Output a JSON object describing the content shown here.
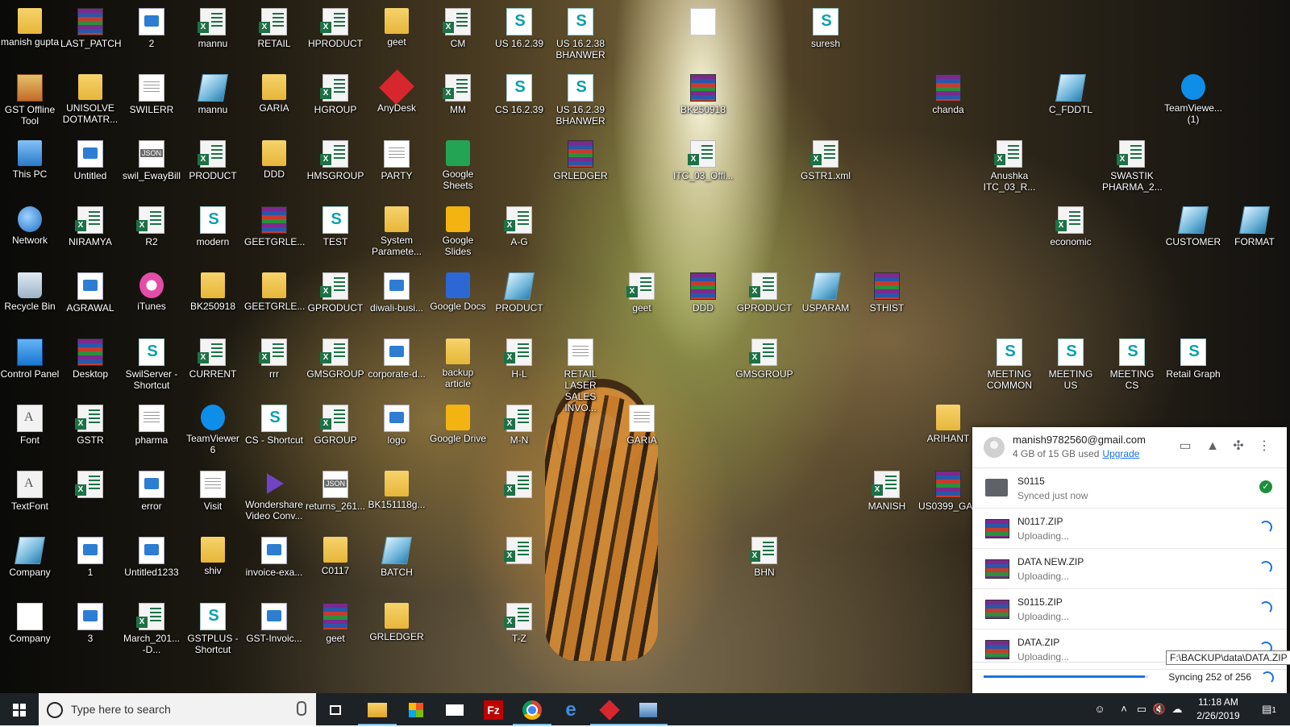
{
  "desktop_icons": [
    {
      "label": "manish gupta",
      "icon": "user-folder-icon"
    },
    {
      "label": "LAST_PATCH",
      "icon": "winrar-icon"
    },
    {
      "label": "2",
      "icon": "image-file-icon"
    },
    {
      "label": "mannu",
      "icon": "excel-file-icon"
    },
    {
      "label": "RETAIL",
      "icon": "excel-file-icon"
    },
    {
      "label": "HPRODUCT",
      "icon": "excel-file-icon"
    },
    {
      "label": "geet",
      "icon": "folder-icon"
    },
    {
      "label": "CM",
      "icon": "excel-file-icon"
    },
    {
      "label": "US 16.2.39",
      "icon": "swil-icon"
    },
    {
      "label": "US 16.2.38 BHANWER",
      "icon": "swil-icon"
    },
    {
      "label": "",
      "icon": "blank-file-icon"
    },
    {
      "label": "suresh",
      "icon": "swil-icon"
    },
    {
      "label": "GST Offline Tool",
      "icon": "gst-tool-icon"
    },
    {
      "label": "UNISOLVE DOTMATR...",
      "icon": "folder-icon"
    },
    {
      "label": "SWILERR",
      "icon": "text-file-icon"
    },
    {
      "label": "mannu",
      "icon": "gem-icon"
    },
    {
      "label": "GARIA",
      "icon": "folder-icon"
    },
    {
      "label": "HGROUP",
      "icon": "excel-file-icon"
    },
    {
      "label": "AnyDesk",
      "icon": "anydesk-icon"
    },
    {
      "label": "MM",
      "icon": "excel-file-icon"
    },
    {
      "label": "CS 16.2.39",
      "icon": "swil-icon"
    },
    {
      "label": "US 16.2.39 BHANWER",
      "icon": "swil-icon"
    },
    {
      "label": "BK250918",
      "icon": "winrar-icon"
    },
    {
      "label": "chanda",
      "icon": "winrar-icon"
    },
    {
      "label": "C_FDDTL",
      "icon": "gem-icon"
    },
    {
      "label": "TeamViewe... (1)",
      "icon": "teamviewer-icon"
    },
    {
      "label": "This PC",
      "icon": "computer-icon"
    },
    {
      "label": "Untitled",
      "icon": "image-file-icon"
    },
    {
      "label": "swil_EwayBill",
      "icon": "json-file-icon"
    },
    {
      "label": "PRODUCT",
      "icon": "excel-file-icon"
    },
    {
      "label": "DDD",
      "icon": "folder-icon"
    },
    {
      "label": "HMSGROUP",
      "icon": "excel-file-icon"
    },
    {
      "label": "PARTY",
      "icon": "text-file-icon"
    },
    {
      "label": "Google Sheets",
      "icon": "google-sheets-icon"
    },
    {
      "label": "GRLEDGER",
      "icon": "winrar-icon"
    },
    {
      "label": "ITC_03_Offl...",
      "icon": "excel-file-icon"
    },
    {
      "label": "GSTR1.xml",
      "icon": "excel-file-icon"
    },
    {
      "label": "Anushka ITC_03_R...",
      "icon": "excel-file-icon"
    },
    {
      "label": "SWASTIK PHARMA_2...",
      "icon": "excel-file-icon"
    },
    {
      "label": "Network",
      "icon": "network-icon"
    },
    {
      "label": "NIRAMYA",
      "icon": "excel-file-icon"
    },
    {
      "label": "R2",
      "icon": "excel-file-icon"
    },
    {
      "label": "modern",
      "icon": "swil-icon"
    },
    {
      "label": "GEETGRLE...",
      "icon": "winrar-icon"
    },
    {
      "label": "TEST",
      "icon": "swil-icon"
    },
    {
      "label": "System Paramete...",
      "icon": "folder-icon"
    },
    {
      "label": "Google Slides",
      "icon": "google-slides-icon"
    },
    {
      "label": "A-G",
      "icon": "excel-file-icon"
    },
    {
      "label": "economic",
      "icon": "excel-file-icon"
    },
    {
      "label": "CUSTOMER",
      "icon": "gem-icon"
    },
    {
      "label": "FORMAT",
      "icon": "gem-icon"
    },
    {
      "label": "Recycle Bin",
      "icon": "recycle-bin-icon"
    },
    {
      "label": "AGRAWAL",
      "icon": "image-file-icon"
    },
    {
      "label": "iTunes",
      "icon": "itunes-icon"
    },
    {
      "label": "BK250918",
      "icon": "folder-icon"
    },
    {
      "label": "GEETGRLE...",
      "icon": "folder-icon"
    },
    {
      "label": "GPRODUCT",
      "icon": "excel-file-icon"
    },
    {
      "label": "diwali-busi...",
      "icon": "image-file-icon"
    },
    {
      "label": "Google Docs",
      "icon": "google-docs-icon"
    },
    {
      "label": "PRODUCT",
      "icon": "gem-icon"
    },
    {
      "label": "geet",
      "icon": "excel-file-icon"
    },
    {
      "label": "DDD",
      "icon": "winrar-icon"
    },
    {
      "label": "GPRODUCT",
      "icon": "excel-file-icon"
    },
    {
      "label": "USPARAM",
      "icon": "gem-icon"
    },
    {
      "label": "STHIST",
      "icon": "winrar-icon"
    },
    {
      "label": "Control Panel",
      "icon": "control-panel-icon"
    },
    {
      "label": "Desktop",
      "icon": "winrar-icon"
    },
    {
      "label": "SwilServer - Shortcut",
      "icon": "swil-icon"
    },
    {
      "label": "CURRENT",
      "icon": "excel-file-icon"
    },
    {
      "label": "rrr",
      "icon": "excel-file-icon"
    },
    {
      "label": "GMSGROUP",
      "icon": "excel-file-icon"
    },
    {
      "label": "corporate-d...",
      "icon": "image-file-icon"
    },
    {
      "label": "backup article",
      "icon": "folder-icon"
    },
    {
      "label": "H-L",
      "icon": "excel-file-icon"
    },
    {
      "label": "RETAIL LASER SALES INVO...",
      "icon": "text-file-icon"
    },
    {
      "label": "GMSGROUP",
      "icon": "excel-file-icon"
    },
    {
      "label": "MEETING COMMON",
      "icon": "swil-icon"
    },
    {
      "label": "MEETING US",
      "icon": "swil-icon"
    },
    {
      "label": "MEETING CS",
      "icon": "swil-icon"
    },
    {
      "label": "Retail Graph",
      "icon": "swil-icon"
    },
    {
      "label": "Font",
      "icon": "font-file-icon"
    },
    {
      "label": "GSTR",
      "icon": "excel-file-icon"
    },
    {
      "label": "pharma",
      "icon": "text-file-icon"
    },
    {
      "label": "TeamViewer 6",
      "icon": "teamviewer-icon"
    },
    {
      "label": "CS - Shortcut",
      "icon": "swil-icon"
    },
    {
      "label": "GGROUP",
      "icon": "excel-file-icon"
    },
    {
      "label": "logo",
      "icon": "image-file-icon"
    },
    {
      "label": "Google Drive",
      "icon": "google-drive-icon"
    },
    {
      "label": "M-N",
      "icon": "excel-file-icon"
    },
    {
      "label": "GARIA",
      "icon": "text-file-icon"
    },
    {
      "label": "ARIHANT",
      "icon": "folder-icon"
    },
    {
      "label": "TextFont",
      "icon": "font-file-icon"
    },
    {
      "label": "",
      "icon": "excel-file-icon"
    },
    {
      "label": "error",
      "icon": "image-file-icon"
    },
    {
      "label": "Visit",
      "icon": "text-file-icon"
    },
    {
      "label": "Wondershare Video Conv...",
      "icon": "wondershare-icon"
    },
    {
      "label": "returns_261...",
      "icon": "json-file-icon"
    },
    {
      "label": "BK151118g...",
      "icon": "folder-icon"
    },
    {
      "label": "",
      "icon": "excel-file-icon"
    },
    {
      "label": "MANISH",
      "icon": "excel-file-icon"
    },
    {
      "label": "US0399_GA...",
      "icon": "winrar-icon"
    },
    {
      "label": "Company",
      "icon": "gem-icon"
    },
    {
      "label": "1",
      "icon": "image-file-icon"
    },
    {
      "label": "Untitled1233",
      "icon": "image-file-icon"
    },
    {
      "label": "shiv",
      "icon": "folder-icon"
    },
    {
      "label": "invoice-exa...",
      "icon": "image-file-icon"
    },
    {
      "label": "C0117",
      "icon": "folder-icon"
    },
    {
      "label": "BATCH",
      "icon": "gem-icon"
    },
    {
      "label": "",
      "icon": "excel-file-icon"
    },
    {
      "label": "BHN",
      "icon": "excel-file-icon"
    },
    {
      "label": "Company",
      "icon": "blank-file-icon"
    },
    {
      "label": "3",
      "icon": "image-file-icon"
    },
    {
      "label": "March_201... -D...",
      "icon": "excel-file-icon"
    },
    {
      "label": "GSTPLUS - Shortcut",
      "icon": "swil-icon"
    },
    {
      "label": "GST-Invoic...",
      "icon": "image-file-icon"
    },
    {
      "label": "geet",
      "icon": "winrar-icon"
    },
    {
      "label": "GRLEDGER",
      "icon": "folder-icon"
    },
    {
      "label": "T-Z",
      "icon": "excel-file-icon"
    }
  ],
  "drive_panel": {
    "account_email": "manish9782560@gmail.com",
    "storage_used": "4 GB of 15 GB used",
    "upgrade_label": "Upgrade",
    "header_icons": [
      "open-folder-icon",
      "google-drive-icon",
      "pinwheel-icon",
      "more-vert-icon"
    ],
    "items": [
      {
        "name": "S0115",
        "status": "Synced just now",
        "icon": "folder-icon",
        "state": "done"
      },
      {
        "name": "N0117.ZIP",
        "status": "Uploading...",
        "icon": "winrar-icon",
        "state": "uploading"
      },
      {
        "name": "DATA NEW.ZIP",
        "status": "Uploading...",
        "icon": "winrar-icon",
        "state": "uploading"
      },
      {
        "name": "S0115.ZIP",
        "status": "Uploading...",
        "icon": "winrar-icon",
        "state": "uploading"
      },
      {
        "name": "DATA.ZIP",
        "status": "Uploading...",
        "icon": "winrar-icon",
        "state": "uploading"
      }
    ],
    "sync_status": "Syncing 252 of 256",
    "sync_progress": 0.98,
    "tooltip": "F:\\BACKUP\\data\\DATA.ZIP"
  },
  "taskbar": {
    "search_placeholder": "Type here to search",
    "apps": [
      "task-view-icon",
      "file-explorer-icon",
      "store-icon",
      "mail-icon",
      "filezilla-icon",
      "chrome-icon",
      "edge-icon",
      "anydesk-icon",
      "network-admin-icon"
    ],
    "tray_icons": [
      "people-icon",
      "chevron-up-icon",
      "network-icon",
      "volume-muted-icon",
      "onedrive-icon"
    ],
    "time": "11:18 AM",
    "date": "2/26/2019",
    "notification_count": "1"
  },
  "colors": {
    "taskbar": "#1d2226",
    "drive_accent": "#1a73e8",
    "synced_green": "#1e8e3e"
  }
}
